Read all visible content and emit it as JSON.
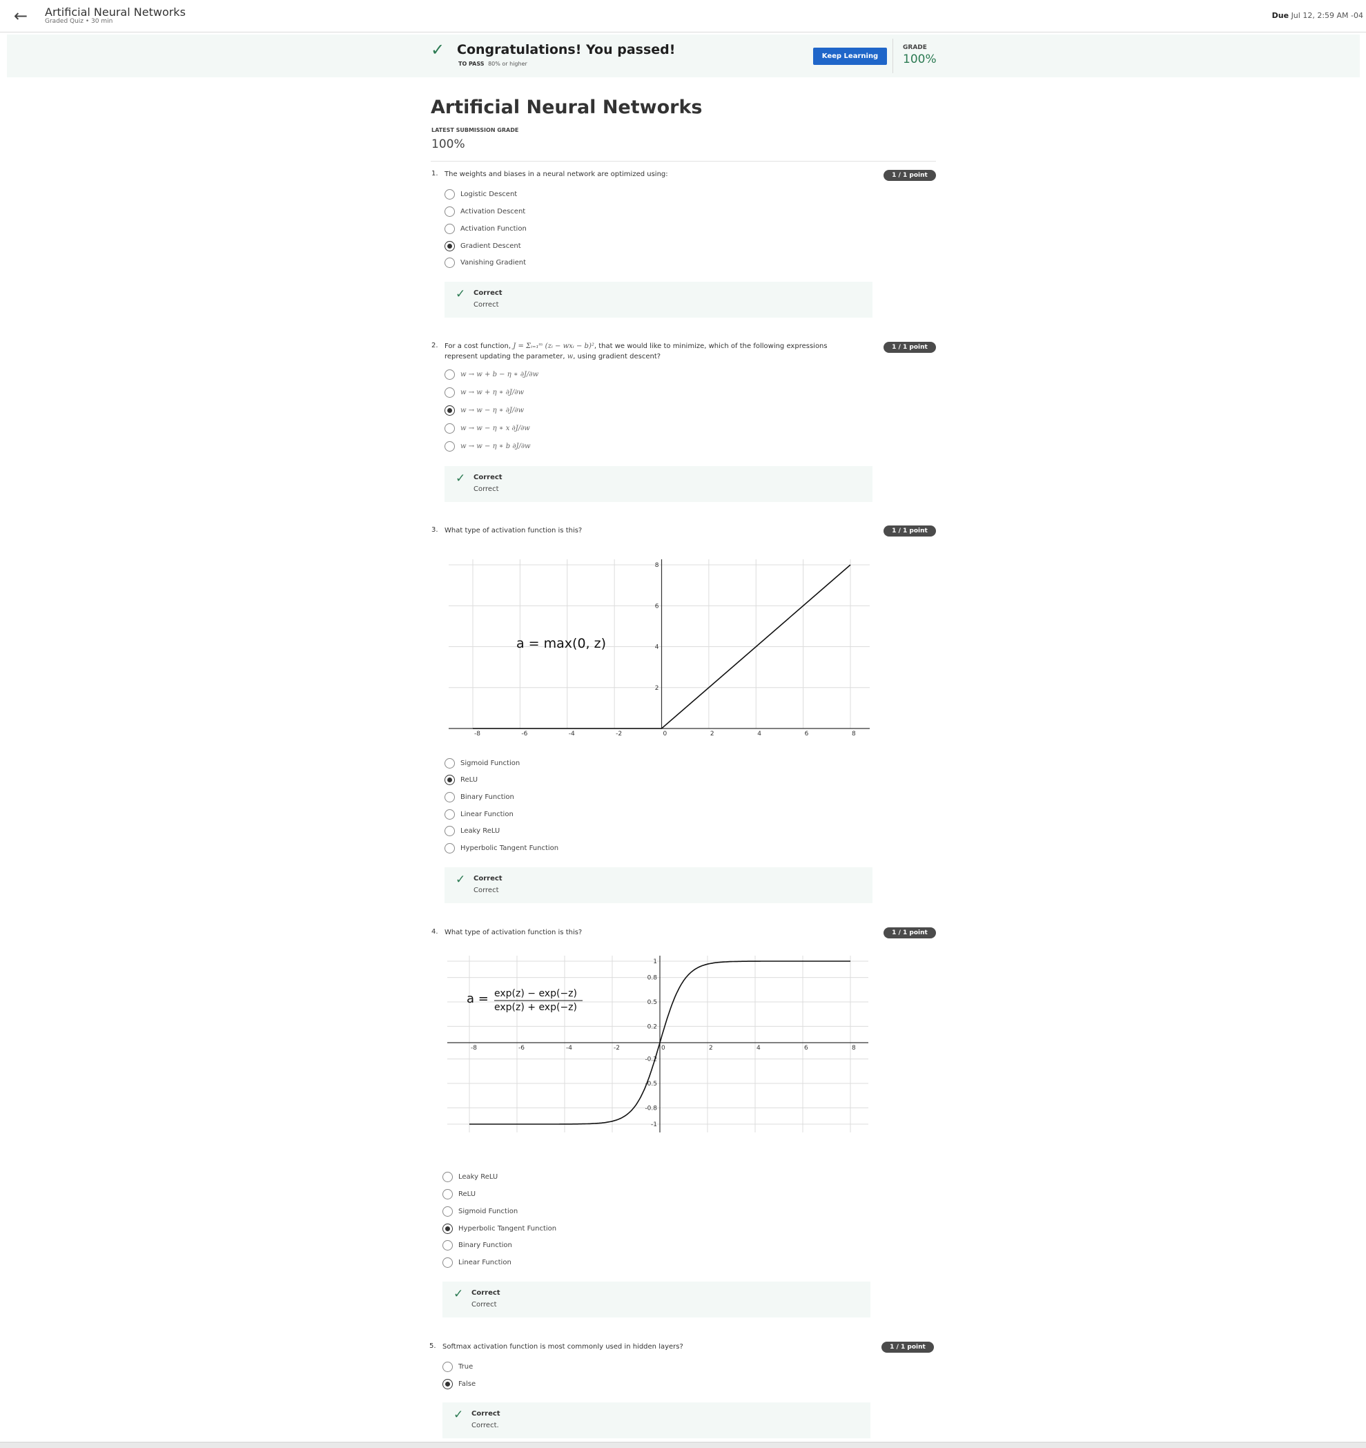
{
  "header": {
    "title": "Artificial Neural Networks",
    "subtitle": "Graded Quiz • 30 min",
    "due_label": "Due",
    "due_value": "Jul 12, 2:59 AM -04"
  },
  "banner": {
    "title": "Congratulations! You passed!",
    "to_pass_label": "TO PASS",
    "to_pass_value": "80% or higher",
    "keep_learning": "Keep Learning",
    "grade_label": "GRADE",
    "grade_value": "100%"
  },
  "page": {
    "title": "Artificial Neural Networks",
    "latest_label": "LATEST SUBMISSION GRADE",
    "latest_value": "100%"
  },
  "questions": [
    {
      "num": "1.",
      "text": "The weights and biases in a neural network are optimized using:",
      "points": "1 / 1 point",
      "options": [
        "Logistic Descent",
        "Activation Descent",
        "Activation Function",
        "Gradient Descent",
        "Vanishing Gradient"
      ],
      "selected": 3,
      "feedback_title": "Correct",
      "feedback_text": "Correct"
    },
    {
      "num": "2.",
      "text_a": "For a cost function, ",
      "math_cost": "J = Σᵢ₌₁ᵐ (zᵢ − wxᵢ − b)²",
      "text_b": ", that we would like to minimize, which of the following expressions",
      "text_c": "represent updating the parameter, ",
      "math_w": "w",
      "text_d": ", using gradient descent?",
      "points": "1 / 1 point",
      "options": [
        "w → w + b − η ∗ ∂J/∂w",
        "w → w + η ∗ ∂J/∂w",
        "w → w − η ∗ ∂J/∂w",
        "w → w − η ∗ x ∂J/∂w",
        "w → w − η ∗ b ∂J/∂w"
      ],
      "selected": 2,
      "feedback_title": "Correct",
      "feedback_text": "Correct"
    },
    {
      "num": "3.",
      "text": "What type of activation function is this?",
      "points": "1 / 1 point",
      "options": [
        "Sigmoid Function",
        "ReLU",
        "Binary Function",
        "Linear Function",
        "Leaky ReLU",
        "Hyperbolic Tangent Function"
      ],
      "selected": 1,
      "feedback_title": "Correct",
      "feedback_text": "Correct"
    },
    {
      "num": "4.",
      "text": "What type of activation function is this?",
      "points": "1 / 1 point",
      "options": [
        "Leaky ReLU",
        "ReLU",
        "Sigmoid Function",
        "Hyperbolic Tangent Function",
        "Binary Function",
        "Linear Function"
      ],
      "selected": 3,
      "feedback_title": "Correct",
      "feedback_text": "Correct"
    },
    {
      "num": "5.",
      "text": "Softmax activation function is most commonly used in hidden layers?",
      "points": "1 / 1 point",
      "options": [
        "True",
        "False"
      ],
      "selected": 1,
      "feedback_title": "Correct",
      "feedback_text": "Correct."
    }
  ],
  "chart_data": [
    {
      "type": "line",
      "annotation": "a = max(0, z)",
      "xlim": [
        -8,
        8
      ],
      "ylim": [
        0,
        8
      ],
      "x_ticks": [
        "-8",
        "-6",
        "-4",
        "-2",
        "0",
        "2",
        "4",
        "6",
        "8"
      ],
      "y_ticks": [
        "2",
        "4",
        "6",
        "8"
      ],
      "grid": true,
      "x": [
        -8,
        0,
        8
      ],
      "y": [
        0,
        0,
        8
      ]
    },
    {
      "type": "line",
      "annotation_lhs": "a =",
      "annotation_num": "exp(z) − exp(−z)",
      "annotation_den": "exp(z) + exp(−z)",
      "xlim": [
        -8,
        8
      ],
      "ylim": [
        -1,
        1
      ],
      "x_ticks": [
        "-8",
        "-6",
        "-4",
        "-2",
        "0",
        "2",
        "4",
        "6",
        "8"
      ],
      "y_ticks": [
        "1",
        "0.8",
        "0.5",
        "0.2",
        "-0.2",
        "-0.5",
        "-0.8",
        "-1"
      ],
      "grid": true,
      "x": [
        -8,
        -4,
        -3,
        -2,
        -1.5,
        -1,
        -0.5,
        0,
        0.5,
        1,
        1.5,
        2,
        3,
        4,
        8
      ],
      "y": [
        -1,
        -0.999,
        -0.995,
        -0.964,
        -0.905,
        -0.762,
        -0.462,
        0,
        0.462,
        0.762,
        0.905,
        0.964,
        0.995,
        0.999,
        1
      ]
    }
  ],
  "icons": {
    "back": "arrow-left-icon",
    "check": "check-icon",
    "accent_green": "#2b7a52",
    "button_blue": "#1f66c9"
  }
}
